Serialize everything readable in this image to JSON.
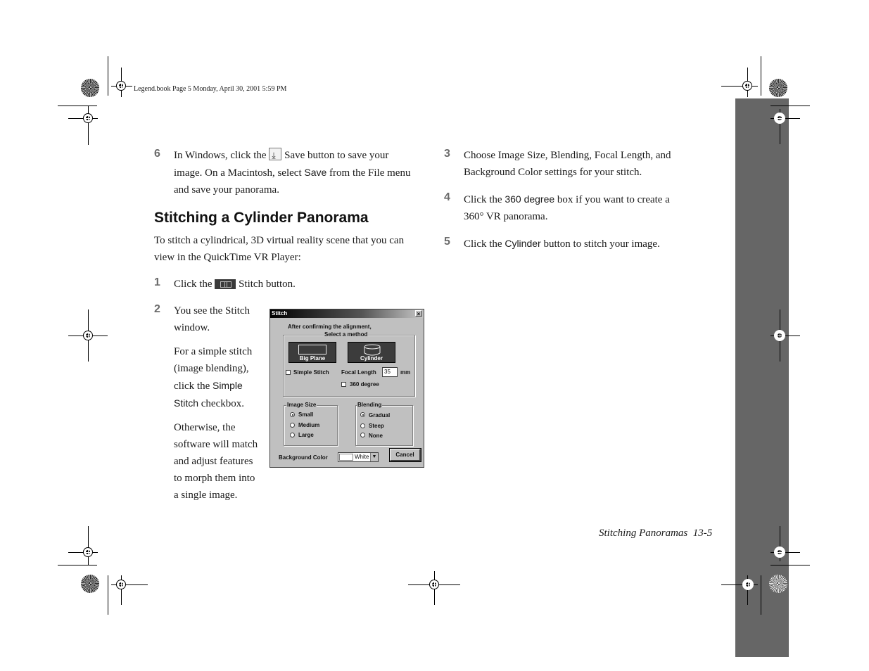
{
  "header": {
    "slug": "Legend.book  Page 5  Monday, April 30, 2001  5:59 PM"
  },
  "left_column": {
    "step6": {
      "number": "6",
      "line1_a": "In Windows, click the",
      "line1_icon": "save-icon",
      "line1_b": "Save button to save your",
      "line2_a": "image. On a Macintosh, select",
      "line2_ui": "Save",
      "line2_b": "from the File menu",
      "line3": "and save your panorama."
    },
    "section_heading": "Stitching a Cylinder Panorama",
    "intro_line1": "To stitch a cylindrical, 3D virtual reality scene that you can",
    "intro_line2": "view in the QuickTime VR Player:",
    "step1": {
      "number": "1",
      "text_a": "Click the",
      "icon": "stitch-icon",
      "text_b": "Stitch button."
    },
    "step2": {
      "number": "2",
      "lines": [
        "You see the Stitch",
        "window."
      ],
      "para2": [
        "For a simple stitch",
        "(image blending),",
        "click the",
        "Simple",
        "Stitch",
        "checkbox."
      ],
      "para3": [
        "Otherwise, the",
        "software will match",
        "and adjust features",
        "to morph them into",
        "a single image."
      ]
    }
  },
  "right_column": {
    "step3": {
      "number": "3",
      "line1": "Choose Image Size, Blending, Focal Length, and",
      "line2": "Background Color settings for your stitch."
    },
    "step4": {
      "number": "4",
      "line1_a": "Click the",
      "line1_ui": "360 degree",
      "line1_b": "box if you want to create a",
      "line2": "360° VR panorama."
    },
    "step5": {
      "number": "5",
      "text_a": "Click the",
      "text_ui": "Cylinder",
      "text_b": "button to stitch your image."
    }
  },
  "dialog": {
    "title": "Stitch",
    "close": "×",
    "instruction": "After confirming the alignment,",
    "method_group": "Select a method",
    "big_plane": "Big Plane",
    "cylinder": "Cylinder",
    "simple_stitch": "Simple Stitch",
    "simple_stitch_checked": false,
    "focal_length_label": "Focal Length",
    "focal_length_value": "35",
    "focal_length_unit": "mm",
    "degree360": "360 degree",
    "degree360_checked": false,
    "image_size": {
      "label": "Image Size",
      "options": [
        "Small",
        "Medium",
        "Large"
      ],
      "selected": "Small"
    },
    "blending": {
      "label": "Blending",
      "options": [
        "Gradual",
        "Steep",
        "None"
      ],
      "selected": "Gradual"
    },
    "bg_color_label": "Background Color",
    "bg_color_value": "White",
    "cancel": "Cancel"
  },
  "footer": {
    "running_title": "Stitching Panoramas",
    "page_number": "13-5"
  },
  "colors": {
    "side_tab": "#666666",
    "step_number": "#6b6b6b",
    "dialog_face": "#c0c0c0"
  }
}
